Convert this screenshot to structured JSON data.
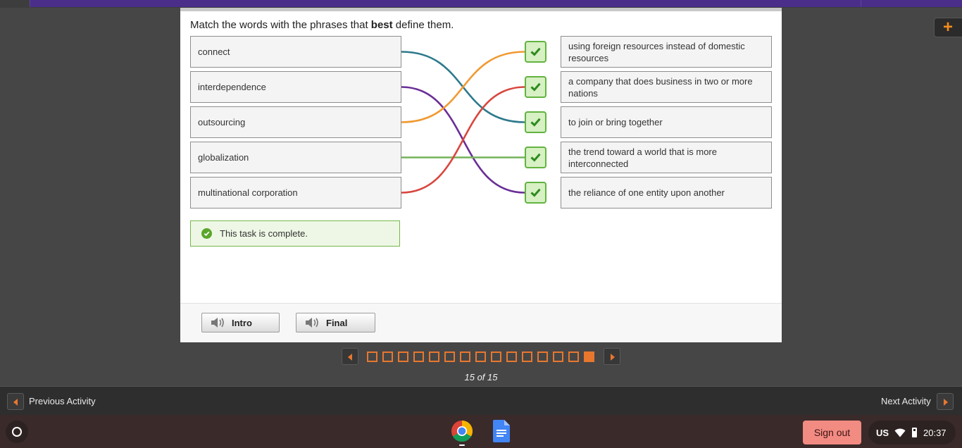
{
  "activity": {
    "instruction_pre": "Match the words with the phrases that ",
    "instruction_bold": "best",
    "instruction_post": " define them.",
    "terms": [
      "connect",
      "interdependence",
      "outsourcing",
      "globalization",
      "multinational corporation"
    ],
    "definitions": [
      "using foreign resources instead of domestic resources",
      "a company that does business in two or more nations",
      "to join or bring together",
      "the trend toward a world that is more interconnected",
      "the reliance of one entity upon another"
    ],
    "matches": [
      {
        "term": 0,
        "definition": 2,
        "color": "#2e7a8c"
      },
      {
        "term": 1,
        "definition": 4,
        "color": "#6a2e96"
      },
      {
        "term": 2,
        "definition": 0,
        "color": "#f09a32"
      },
      {
        "term": 3,
        "definition": 3,
        "color": "#74b35a"
      },
      {
        "term": 4,
        "definition": 1,
        "color": "#d8473e"
      }
    ],
    "complete_message": "This task is complete."
  },
  "footer": {
    "intro_label": "Intro",
    "final_label": "Final"
  },
  "pager": {
    "current": 15,
    "total": 15,
    "count_text": "15 of 15"
  },
  "activity_nav": {
    "previous_label": "Previous Activity",
    "next_label": "Next Activity"
  },
  "shelf": {
    "signout_label": "Sign out",
    "lang": "US",
    "time": "20:37"
  },
  "colors": {
    "accent": "#e8772e",
    "check_border": "#62b340",
    "check_fill": "#d7f0c4",
    "signout": "#f28b82",
    "topbar": "#4b2d8a"
  }
}
